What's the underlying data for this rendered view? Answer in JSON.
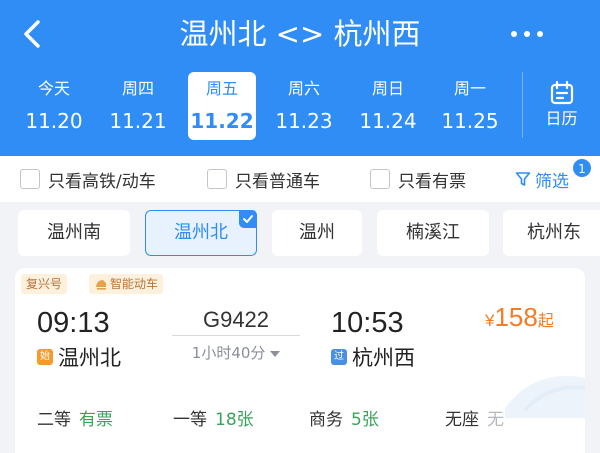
{
  "header": {
    "title": "温州北 <> 杭州西",
    "calendar_label": "日历"
  },
  "dates": [
    {
      "weekday": "今天",
      "date": "11.20",
      "active": false
    },
    {
      "weekday": "周四",
      "date": "11.21",
      "active": false
    },
    {
      "weekday": "周五",
      "date": "11.22",
      "active": true
    },
    {
      "weekday": "周六",
      "date": "11.23",
      "active": false
    },
    {
      "weekday": "周日",
      "date": "11.24",
      "active": false
    },
    {
      "weekday": "周一",
      "date": "11.25",
      "active": false
    }
  ],
  "filters": {
    "high_speed": "只看高铁/动车",
    "normal": "只看普通车",
    "available": "只看有票",
    "screen_label": "筛选",
    "screen_badge": "1"
  },
  "stations": [
    {
      "name": "温州南",
      "active": false
    },
    {
      "name": "温州北",
      "active": true
    },
    {
      "name": "温州",
      "active": false
    },
    {
      "name": "楠溪江",
      "active": false
    },
    {
      "name": "杭州东",
      "active": false
    }
  ],
  "train": {
    "tags": [
      "复兴号",
      "智能动车"
    ],
    "depart_time": "09:13",
    "arrive_time": "10:53",
    "train_no": "G9422",
    "duration": "1小时40分",
    "depart_station": "温州北",
    "depart_badge": "始",
    "arrive_station": "杭州西",
    "arrive_badge": "过",
    "price_currency": "¥",
    "price": "158",
    "price_suffix": "起",
    "seats": [
      {
        "class": "二等",
        "status": "有票"
      },
      {
        "class": "一等",
        "status": "18张"
      },
      {
        "class": "商务",
        "status": "5张"
      },
      {
        "class": "无座",
        "status": "无"
      }
    ]
  },
  "colors": {
    "brand_blue": "#2f8df5",
    "price_orange": "#f57c23",
    "available_green": "#3aa35a"
  }
}
